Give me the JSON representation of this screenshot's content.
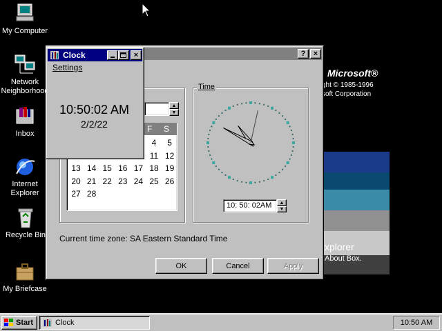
{
  "desktop": {
    "icons": [
      {
        "label_lines": [
          "My Computer"
        ]
      },
      {
        "label_lines": [
          "Network",
          "Neighborhood"
        ]
      },
      {
        "label_lines": [
          "Inbox"
        ]
      },
      {
        "label_lines": [
          "Internet",
          "Explorer"
        ]
      },
      {
        "label_lines": [
          "Recycle Bin"
        ]
      },
      {
        "label_lines": [
          "My Briefcase"
        ]
      }
    ]
  },
  "splash": {
    "brand": "Microsoft®",
    "copyright_line1": "ght © 1985-1996",
    "copyright_line2": "soft Corporation",
    "product": "xplorer",
    "about": "About Box."
  },
  "datetime_dialog": {
    "help_button": "?",
    "close_button": "×",
    "time_group_label": "Time",
    "time_value": "10: 50: 02AM",
    "calendar": {
      "day_headers_visible": [
        "F",
        "S"
      ],
      "weeks": [
        [
          "",
          "",
          "",
          "",
          "",
          "4",
          "5"
        ],
        [
          "",
          "",
          "",
          "",
          "",
          "11",
          "12"
        ],
        [
          "13",
          "14",
          "15",
          "16",
          "17",
          "18",
          "19"
        ],
        [
          "20",
          "21",
          "22",
          "23",
          "24",
          "25",
          "26"
        ],
        [
          "27",
          "28",
          "",
          "",
          "",
          "",
          ""
        ]
      ]
    },
    "timezone_text": "Current time zone:  SA Eastern Standard Time",
    "ok_label": "OK",
    "cancel_label": "Cancel",
    "apply_label": "Apply",
    "apply_disabled": true,
    "analog_time": {
      "hour": 10,
      "minute": 50,
      "second": 2
    }
  },
  "clock_window": {
    "title": "Clock",
    "menu_settings": "Settings",
    "time": "10:50:02 AM",
    "date": "2/2/22"
  },
  "taskbar": {
    "start_label": "Start",
    "task_label": "Clock",
    "tray_time": "10:50 AM"
  },
  "colors": {
    "desktop": "#000000",
    "face": "#c0c0c0",
    "active_title": "#000080",
    "inactive_title": "#808080",
    "clock_marker": "#3aa6a0"
  }
}
